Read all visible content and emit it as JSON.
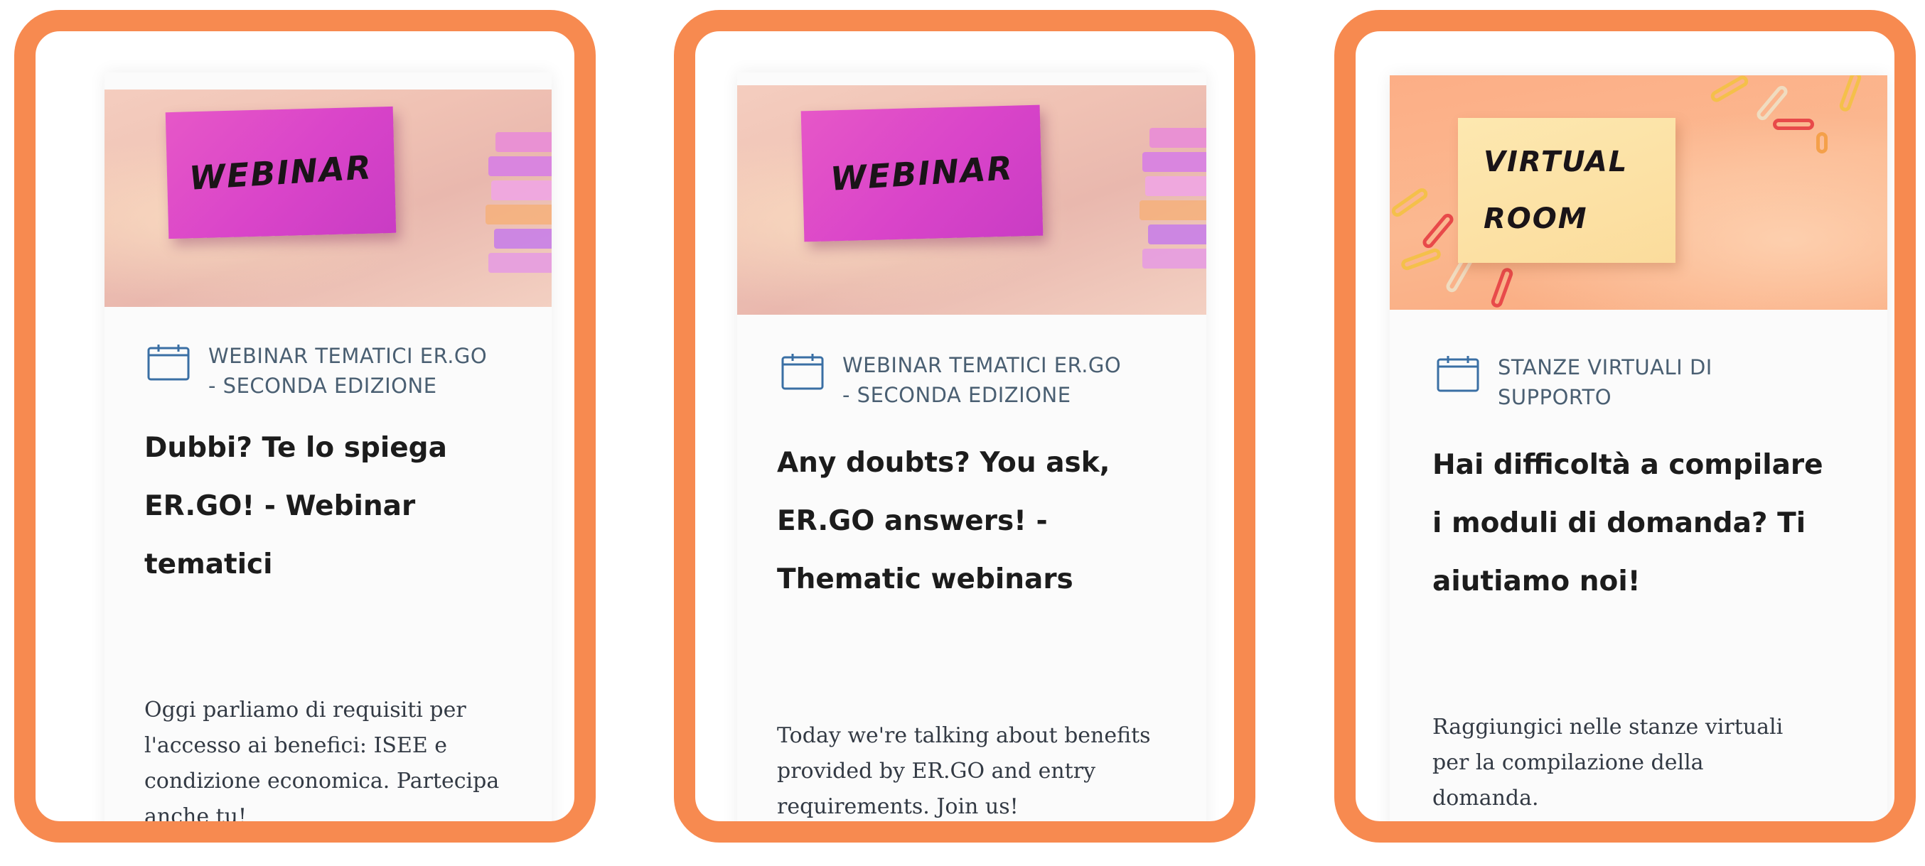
{
  "colors": {
    "frame_border": "#f78a50",
    "category_text": "#4a5f72",
    "title_text": "#1c1c1c",
    "body_text": "#333a44"
  },
  "cards": [
    {
      "image_note": "WEBINAR",
      "category": "WEBINAR TEMATICI ER.GO\n- SECONDA EDIZIONE",
      "title": "Dubbi? Te lo spiega\nER.GO! - Webinar\ntematici",
      "description": "Oggi parliamo di requisiti per\nl'accesso ai benefici: ISEE e\ncondizione economica. Partecipa\nanche tu!",
      "icon": "calendar-icon"
    },
    {
      "image_note": "WEBINAR",
      "category": "WEBINAR TEMATICI ER.GO\n- SECONDA EDIZIONE",
      "title": "Any doubts? You ask,\nER.GO answers! -\nThematic webinars",
      "description": "Today we're talking about benefits\nprovided by ER.GO and entry\nrequirements. Join us!",
      "icon": "calendar-icon"
    },
    {
      "image_note_line1": "VIRTUAL",
      "image_note_line2": "ROOM",
      "category": "STANZE VIRTUALI DI\nSUPPORTO",
      "title": "Hai difficoltà a compilare\ni moduli di domanda? Ti\naiutiamo noi!",
      "description": "Raggiungici nelle stanze virtuali\nper la compilazione della\ndomanda.",
      "icon": "calendar-icon"
    }
  ]
}
